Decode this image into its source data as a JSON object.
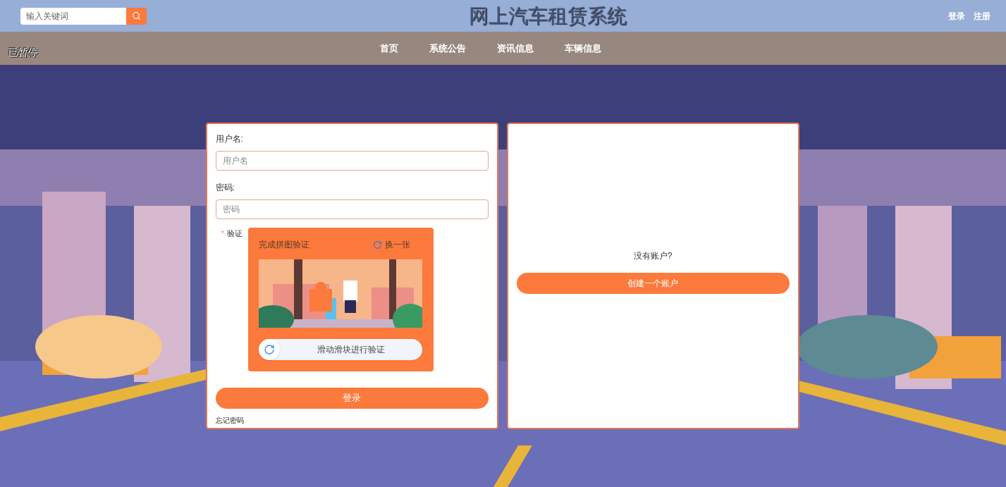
{
  "header": {
    "search": {
      "placeholder": "输入关键词"
    },
    "title": "网上汽车租赁系统",
    "links": [
      "登录",
      "注册"
    ]
  },
  "nav": {
    "status": "已暂停",
    "items": [
      "首页",
      "系统公告",
      "资讯信息",
      "车辆信息"
    ]
  },
  "login": {
    "username_label": "用户名:",
    "username": {
      "placeholder": "用户名"
    },
    "password_label": "密码:",
    "password": {
      "placeholder": "密码"
    },
    "captcha": {
      "required_mark": "*",
      "label": "验证",
      "title": "完成拼图验证",
      "refresh": "换一张",
      "slider_text": "滑动滑块进行验证"
    },
    "submit": "登录",
    "forgot": "忘记密码"
  },
  "register": {
    "prompt": "没有账户?",
    "button": "创建一个账户"
  }
}
